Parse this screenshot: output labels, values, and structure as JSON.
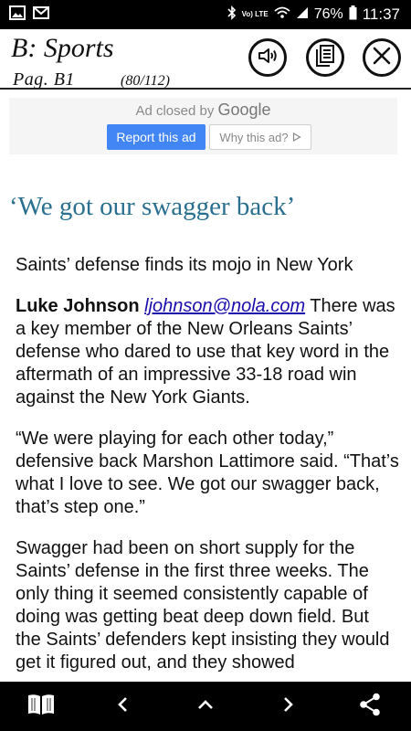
{
  "status_bar": {
    "battery_percent": "76%",
    "time": "11:37",
    "network_label": "Vo) LTE",
    "icons": [
      "gallery-icon",
      "mail-icon",
      "bluetooth-icon",
      "wifi-icon",
      "signal-icon",
      "battery-icon"
    ]
  },
  "header": {
    "section": "B: Sports",
    "page": "Pag. B1",
    "count": "(80/112)",
    "buttons": [
      "speaker-icon",
      "article-list-icon",
      "close-icon"
    ]
  },
  "ad": {
    "closed_prefix": "Ad closed by",
    "closed_brand": "Google",
    "report_label": "Report this ad",
    "why_label": "Why this ad?"
  },
  "article": {
    "headline": "‘We got our swagger back’",
    "subhead": "Saints’ defense finds its mojo in New York",
    "author": "Luke Johnson",
    "email": "ljohnson@nola.com",
    "p1_rest": " There was a key member of the New Orleans Saints’ defense who dared to use that key word in the aftermath of an impressive 33-18 road win against the New York Giants.",
    "p2": "“We were playing for each other today,” defensive back Marshon Lattimore said. “That’s what I love to see. We got our swagger back, that’s step one.”",
    "p3": "Swagger had been on short supply for the Saints’ defense in the first three weeks. The only thing it seemed consistently capable of doing was getting beat deep down field. But the Saints’ defenders kept insisting they would get it figured out, and they showed"
  },
  "bottom_nav": [
    "book-icon",
    "previous-icon",
    "up-icon",
    "next-icon",
    "share-icon"
  ]
}
